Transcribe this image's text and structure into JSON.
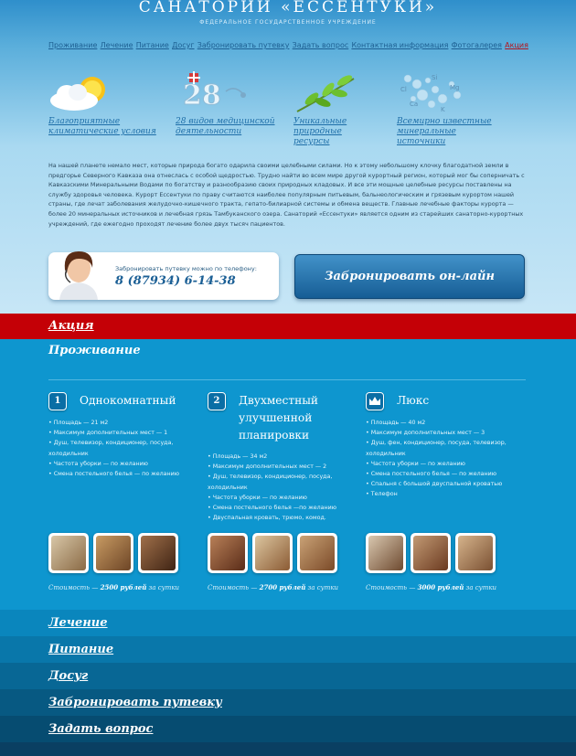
{
  "header": {
    "title": "САНАТОРИЙ «ЕССЕНТУКИ»",
    "subtitle": "ФЕДЕРАЛЬНОЕ ГОСУДАРСТВЕННОЕ УЧРЕЖДЕНИЕ"
  },
  "nav": [
    "Проживание",
    "Лечение",
    "Питание",
    "Досуг",
    "Забронировать путевку",
    "Задать вопрос",
    "Контактная информация",
    "Фотогалерея",
    "Акция"
  ],
  "features": [
    {
      "label": "Благоприятные климатические условия",
      "icon": "sun-cloud-icon"
    },
    {
      "label": "28 видов медицинской деятельности",
      "icon": "number-28-icon",
      "badge": "28"
    },
    {
      "label": "Уникальные природные ресурсы",
      "icon": "green-branch-icon"
    },
    {
      "label": "Всемирно известные минеральные источники",
      "icon": "mineral-bubbles-icon",
      "elements": [
        "Si",
        "Mg",
        "Cl",
        "Ca",
        "K"
      ]
    }
  ],
  "intro": "На нашей планете немало мест, которые природа богато одарила своими целебными силами. Но к этому небольшому клочку благодатной земли в предгорье Северного Кавказа она отнеслась с особой щедростью. Трудно найти во всем мире другой курортный регион, который мог бы соперничать с Кавказскими Минеральными Водами по богатству и разнообразию своих природных кладовых. И все эти мощные целебные ресурсы поставлены на службу здоровья человека. Курорт Ессентуки по праву считаются наиболее популярным питьевым, бальнеологическим и грязевым курортом нашей страны, где лечат заболевания желудочно-кишечного тракта, гепато-билиарной системы и обмена веществ. Главные лечебные факторы курорта — более 20 минеральных источников и лечебная грязь Тамбуканского озера. Санаторий «Ессентуки» является одним из старейших санаторно-курортных учреждений, где ежегодно проходят лечение более двух тысяч пациентов.",
  "phone": {
    "caption": "Забронировать путевку можно по телефону:",
    "number": "8 (87934) 6-14-38"
  },
  "book_button": "Забронировать он-лайн",
  "promo": "Акция",
  "living": {
    "title": "Проживание",
    "rooms": [
      {
        "num": "1",
        "title": "Однокомнатный",
        "features": [
          "Площадь — 21 м2",
          "Максимум дополнительных мест — 1",
          "Душ, телевизор, кондиционер, посуда, холодильник",
          "Частота уборки — по желанию",
          "Смена постельного белья — по желанию"
        ],
        "price_prefix": "Стоимость —",
        "price": "2500 рублей",
        "price_suffix": "за сутки"
      },
      {
        "num": "2",
        "title": "Двухместный улучшенной планировки",
        "features": [
          "Площадь — 34 м2",
          "Максимум дополнительных мест — 2",
          "Душ, телевизор, кондиционер, посуда, холодильник",
          "Частота уборки — по желанию",
          "Смена постельного белья —по желанию",
          "Двуспальная кровать, трюмо, комод."
        ],
        "price_prefix": "Стоимость —",
        "price": "2700 рублей",
        "price_suffix": "за сутки"
      },
      {
        "num": "crown",
        "title": "Люкс",
        "features": [
          "Площадь — 40 м2",
          "Максимум дополнительных мест — 3",
          "Душ, фен, кондиционер, посуда, телевизор, холодильник",
          "Частота уборки — по желанию",
          "Смена постельного белья — по желанию",
          "Спальня с большой двуспальной кроватью",
          "Телефон"
        ],
        "price_prefix": "Стоимость —",
        "price": "3000 рублей",
        "price_suffix": "за сутки"
      }
    ]
  },
  "bottom_sections": [
    "Лечение",
    "Питание",
    "Досуг",
    "Забронировать путевку",
    "Задать вопрос"
  ],
  "colors": {
    "promo_bar": "#c40006",
    "main_blue": "#0e96cf",
    "nav_link": "#1d5f92"
  }
}
